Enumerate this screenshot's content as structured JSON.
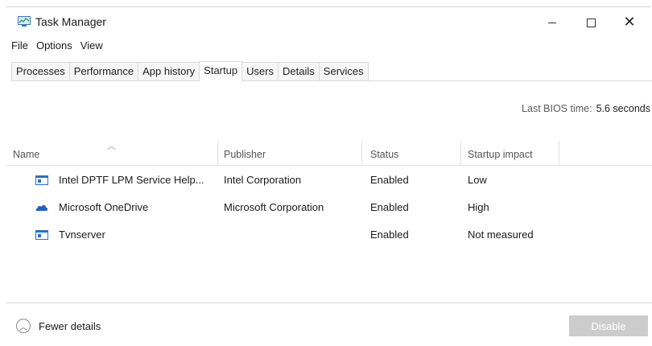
{
  "window": {
    "title": "Task Manager"
  },
  "menu": [
    "File",
    "Options",
    "View"
  ],
  "tabs": [
    "Processes",
    "Performance",
    "App history",
    "Startup",
    "Users",
    "Details",
    "Services"
  ],
  "active_tab": "Startup",
  "bios": {
    "label": "Last BIOS time:",
    "value": "5.6 seconds"
  },
  "columns": [
    "Name",
    "Publisher",
    "Status",
    "Startup impact"
  ],
  "rows": [
    {
      "name": "Intel DPTF LPM Service Help...",
      "publisher": "Intel Corporation",
      "status": "Enabled",
      "impact": "Low",
      "icon": "app-window-icon"
    },
    {
      "name": "Microsoft OneDrive",
      "publisher": "Microsoft Corporation",
      "status": "Enabled",
      "impact": "High",
      "icon": "onedrive-cloud-icon"
    },
    {
      "name": "Tvnserver",
      "publisher": "",
      "status": "Enabled",
      "impact": "Not measured",
      "icon": "app-window-icon"
    }
  ],
  "footer": {
    "fewer_details": "Fewer details",
    "disable": "Disable"
  },
  "colors": {
    "onedrive": "#1f5fc0",
    "window_icon_frame": "#2a6fc9",
    "disabled_button": "#cccccc"
  }
}
